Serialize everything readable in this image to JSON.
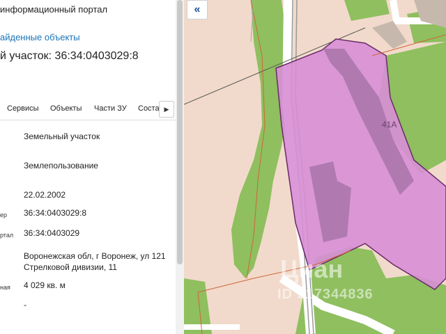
{
  "header": {
    "portal_title": "информационный портал",
    "back_link": "айденные объекты",
    "parcel_heading": "й участок: 36:34:0403029:8"
  },
  "tabs": [
    {
      "label": "Сервисы"
    },
    {
      "label": "Объекты"
    },
    {
      "label": "Части ЗУ"
    },
    {
      "label": "Соста"
    }
  ],
  "tab_scroll_icon": "chevron-right-icon",
  "details": [
    {
      "label": "",
      "value": "Земельный участок"
    },
    {
      "label": "",
      "value": "Землепользование"
    },
    {
      "label": "",
      "value": "22.02.2002"
    },
    {
      "label": "ер",
      "value": "36:34:0403029:8"
    },
    {
      "label": "ртал",
      "value": "36:34:0403029"
    },
    {
      "label": "",
      "value": "Воронежская обл, г Воронеж, ул 121 Стрелковой дивизии, 11"
    },
    {
      "label": "ная",
      "value": "4 029 кв. м"
    },
    {
      "label": "",
      "value": "-"
    }
  ],
  "map": {
    "collapse_icon": "double-chevron-left-icon",
    "collapse_glyph": "«",
    "building_label": "41А",
    "watermark": "Циан",
    "watermark_id": "ID 317344836",
    "colors": {
      "background": "#f1dacb",
      "green": "#8fbf5f",
      "parcel": "#d78ed6",
      "parcel_border": "#6b2a68",
      "building": "#c7b8ad",
      "road": "#ffffff",
      "boundary": "#d2643c"
    }
  }
}
